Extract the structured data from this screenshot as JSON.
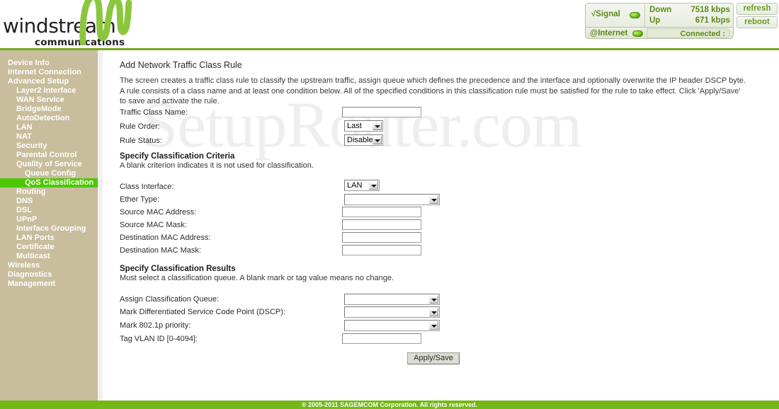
{
  "brand": {
    "name": "windstream",
    "tm": "™",
    "tagline": "communications",
    "logo_icon": "windstream-wave-logo",
    "green": "#76a61d"
  },
  "status": {
    "signal_label": "√Signal",
    "signal_led": "led-green",
    "down_label": "Down",
    "down_value": "7518 kbps",
    "up_label": "Up",
    "up_value": "671 kbps",
    "internet_label": "@Internet",
    "internet_led": "led-green",
    "internet_status": "Connected :",
    "refresh_label": "refresh",
    "reboot_label": "reboot"
  },
  "sidebar": {
    "items": [
      {
        "label": "Device Info",
        "level": 0,
        "active": false
      },
      {
        "label": "Internet Connection",
        "level": 0,
        "active": false
      },
      {
        "label": "Advanced Setup",
        "level": 0,
        "active": false
      },
      {
        "label": "Layer2 Interface",
        "level": 1,
        "active": false
      },
      {
        "label": "WAN Service",
        "level": 1,
        "active": false
      },
      {
        "label": "BridgeMode",
        "level": 1,
        "active": false
      },
      {
        "label": "AutoDetection",
        "level": 1,
        "active": false
      },
      {
        "label": "LAN",
        "level": 1,
        "active": false
      },
      {
        "label": "NAT",
        "level": 1,
        "active": false
      },
      {
        "label": "Security",
        "level": 1,
        "active": false
      },
      {
        "label": "Parental Control",
        "level": 1,
        "active": false
      },
      {
        "label": "Quality of Service",
        "level": 1,
        "active": false
      },
      {
        "label": "Queue Config",
        "level": 2,
        "active": false
      },
      {
        "label": "QoS Classification",
        "level": 2,
        "active": true
      },
      {
        "label": "Routing",
        "level": 1,
        "active": false
      },
      {
        "label": "DNS",
        "level": 1,
        "active": false
      },
      {
        "label": "DSL",
        "level": 1,
        "active": false
      },
      {
        "label": "UPnP",
        "level": 1,
        "active": false
      },
      {
        "label": "Interface Grouping",
        "level": 1,
        "active": false
      },
      {
        "label": "LAN Ports",
        "level": 1,
        "active": false
      },
      {
        "label": "Certificate",
        "level": 1,
        "active": false
      },
      {
        "label": "Multicast",
        "level": 1,
        "active": false
      },
      {
        "label": "Wireless",
        "level": 0,
        "active": false
      },
      {
        "label": "Diagnostics",
        "level": 0,
        "active": false
      },
      {
        "label": "Management",
        "level": 0,
        "active": false
      }
    ]
  },
  "main": {
    "watermark": "SetupRouter.com",
    "title": "Add Network Traffic Class Rule",
    "description": "The screen creates a traffic class rule to classify the upstream traffic, assign queue which defines the precedence and the interface and optionally overwrite the IP header DSCP byte. A rule consists of a class name and at least one condition below. All of the specified conditions in this classification rule must be satisfied for the rule to take effect. Click 'Apply/Save' to save and activate the rule.",
    "fields": {
      "traffic_class_name_label": "Traffic Class Name:",
      "traffic_class_name_value": "",
      "rule_order_label": "Rule Order:",
      "rule_order_value": "Last",
      "rule_status_label": "Rule Status:",
      "rule_status_value": "Disable"
    },
    "criteria": {
      "heading": "Specify Classification Criteria",
      "subtext": "A blank criterion indicates it is not used for classification.",
      "class_interface_label": "Class Interface:",
      "class_interface_value": "LAN",
      "ether_type_label": "Ether Type:",
      "ether_type_value": "",
      "source_mac_address_label": "Source MAC Address:",
      "source_mac_address_value": "",
      "source_mac_mask_label": "Source MAC Mask:",
      "source_mac_mask_value": "",
      "destination_mac_address_label": "Destination MAC Address:",
      "destination_mac_address_value": "",
      "destination_mac_mask_label": "Destination MAC Mask:",
      "destination_mac_mask_value": ""
    },
    "results": {
      "heading": "Specify Classification Results",
      "subtext": "Must select a classification queue. A blank mark or tag value means no change.",
      "assign_queue_label": "Assign Classification Queue:",
      "assign_queue_value": "",
      "dscp_label": "Mark Differentiated Service Code Point (DSCP):",
      "dscp_value": "",
      "priority_label": "Mark 802.1p priority:",
      "priority_value": "",
      "vlan_label": "Tag VLAN ID [0-4094]:",
      "vlan_value": ""
    },
    "apply_button": "Apply/Save"
  },
  "footer": {
    "copyright": "® 2005-2011 SAGEMCOM Corporation. All rights reserved."
  }
}
